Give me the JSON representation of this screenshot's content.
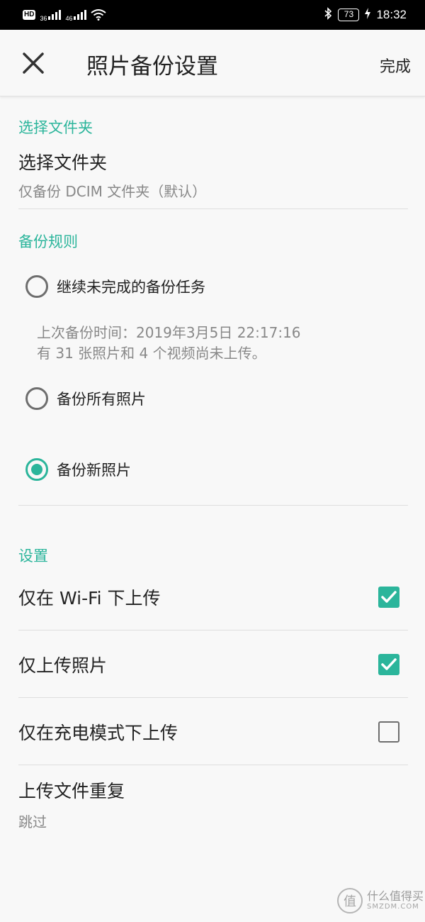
{
  "status_bar": {
    "hd": "HD",
    "net1": "36",
    "net2": "46",
    "battery": "73",
    "time": "18:32"
  },
  "app_bar": {
    "title": "照片备份设置",
    "done_label": "完成"
  },
  "folder_section": {
    "header": "选择文件夹",
    "title": "选择文件夹",
    "subtitle": "仅备份 DCIM 文件夹（默认）"
  },
  "rules_section": {
    "header": "备份规则",
    "options": [
      {
        "label": "继续未完成的备份任务",
        "selected": false
      },
      {
        "label": "备份所有照片",
        "selected": false
      },
      {
        "label": "备份新照片",
        "selected": true
      }
    ],
    "note_line1": "上次备份时间：2019年3月5日 22:17:16",
    "note_line2": "有 31 张照片和 4 个视频尚未上传。"
  },
  "settings_section": {
    "header": "设置",
    "items": [
      {
        "label": "仅在 Wi-Fi 下上传",
        "checked": true
      },
      {
        "label": "仅上传照片",
        "checked": true
      },
      {
        "label": "仅在充电模式下上传",
        "checked": false
      }
    ],
    "duplicate_title": "上传文件重复",
    "duplicate_value": "跳过"
  },
  "watermark": {
    "glyph": "值",
    "cn": "什么值得买",
    "en": "SMZDM.COM"
  },
  "colors": {
    "accent": "#2bb59b",
    "status_bar": "#000000",
    "background": "#f8f8f8"
  }
}
